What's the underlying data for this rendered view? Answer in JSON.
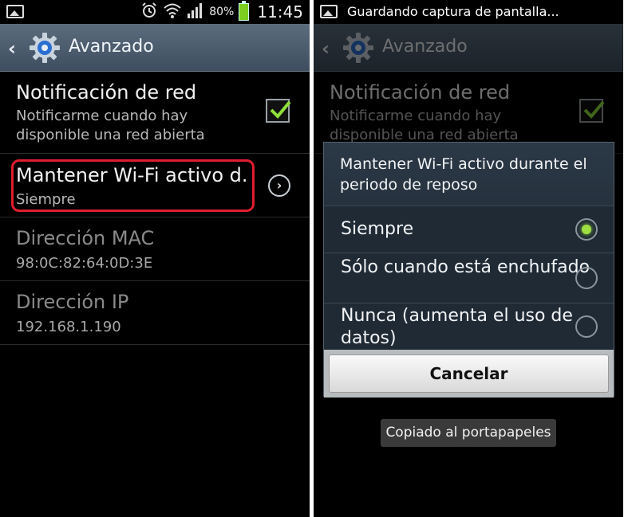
{
  "status_bar": {
    "battery_percent": "80%",
    "time": "11:45",
    "notification": "Guardando captura de pantalla..."
  },
  "action_bar": {
    "title": "Avanzado"
  },
  "settings": {
    "items": [
      {
        "title": "Notificación de red",
        "summary": "Notificarme cuando hay disponible una red abierta",
        "checked": true
      },
      {
        "title": "Mantener Wi-Fi activo d.",
        "summary": "Siempre"
      },
      {
        "title": "Dirección MAC",
        "summary": "98:0C:82:64:0D:3E"
      },
      {
        "title": "Dirección IP",
        "summary": "192.168.1.190"
      }
    ]
  },
  "dialog": {
    "title": "Mantener Wi-Fi activo durante el periodo de reposo",
    "options": [
      {
        "label": "Siempre",
        "selected": true
      },
      {
        "label": "Sólo cuando está enchufado",
        "selected": false
      },
      {
        "label": "Nunca (aumenta el uso de datos)",
        "selected": false
      }
    ],
    "cancel_label": "Cancelar"
  },
  "toast": "Copiado al portapapeles",
  "colors": {
    "highlight": "#e01d2c",
    "accent_green": "#9ee043",
    "action_bar": "#4a5b6c",
    "battery": "#7ccd1f"
  }
}
